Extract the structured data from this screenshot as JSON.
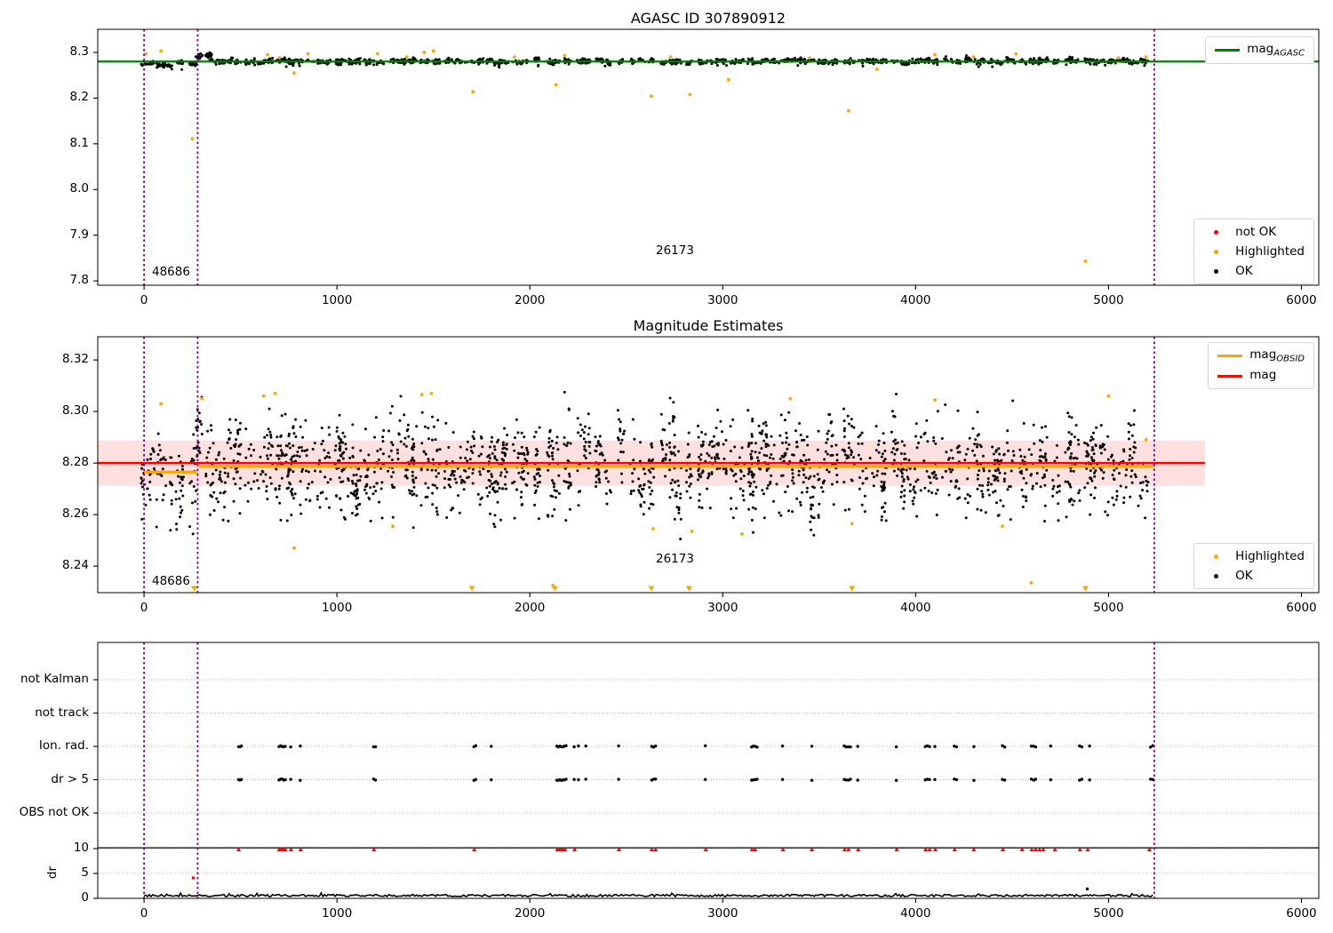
{
  "colors": {
    "ok": "#000000",
    "not_ok": "#ff0000",
    "highlighted": "#ffa500",
    "mag_agasc_line": "#008000",
    "mag_line": "#ff0000",
    "mag_obsid_line": "#ffa500",
    "vline": "#800080",
    "band_fill": "rgba(255,0,0,0.12)",
    "grid": "#bbbbbb",
    "spine": "#000000"
  },
  "chart_data": [
    {
      "type": "scatter",
      "panel": "top",
      "title": "AGASC ID 307890912",
      "xlim": [
        -240,
        6090
      ],
      "ylim": [
        7.7905,
        8.3505
      ],
      "xticks": [
        0,
        1000,
        2000,
        3000,
        4000,
        5000,
        6000
      ],
      "xtick_labels": [
        "0",
        "1000",
        "2000",
        "3000",
        "4000",
        "5000",
        "6000"
      ],
      "yticks": [
        7.8,
        7.9,
        8.0,
        8.1,
        8.2,
        8.3
      ],
      "ytick_labels": [
        "7.8",
        "7.9",
        "8.0",
        "8.1",
        "8.2",
        "8.3"
      ],
      "mag_agasc": 8.28,
      "vlines": [
        0,
        278,
        5237
      ],
      "annotations": [
        {
          "text": "48686",
          "x": 40,
          "y": 7.818
        },
        {
          "text": "26173",
          "x": 2655,
          "y": 7.864
        }
      ],
      "legend_line": [
        {
          "label": "mag",
          "sub": "AGASC"
        }
      ],
      "legend_markers": [
        {
          "label": "not OK",
          "color_key": "not_ok"
        },
        {
          "label": "Highlighted",
          "color_key": "highlighted"
        },
        {
          "label": "OK",
          "color_key": "ok"
        }
      ],
      "band": {
        "seed": 20,
        "x_start": 10,
        "x_end": 5230,
        "mean": 8.2805,
        "sd": 0.0028,
        "cluster_sd": 0.0016,
        "first_seg_end": 278,
        "first_seg_mean": 8.2737,
        "first_seg_sd": 0.0022,
        "bump_range": [
          282,
          368
        ],
        "bump_mean": 8.2915,
        "clip": [
          8.252,
          8.308
        ],
        "pts_min": 8,
        "pts_max": 22,
        "low_frac": 0.015,
        "low_extra": 0.006
      },
      "highlighted_points": [
        [
          10,
          8.297
        ],
        [
          88,
          8.303
        ],
        [
          250,
          8.111
        ],
        [
          640,
          8.295
        ],
        [
          702,
          8.288
        ],
        [
          778,
          8.255
        ],
        [
          850,
          8.297
        ],
        [
          1210,
          8.297
        ],
        [
          1362,
          8.29
        ],
        [
          1452,
          8.3
        ],
        [
          1500,
          8.303
        ],
        [
          1705,
          8.214
        ],
        [
          1920,
          8.29
        ],
        [
          2135,
          8.229
        ],
        [
          2180,
          8.293
        ],
        [
          2630,
          8.204
        ],
        [
          2730,
          8.29
        ],
        [
          2830,
          8.208
        ],
        [
          3030,
          8.24
        ],
        [
          3450,
          8.288
        ],
        [
          3652,
          8.172
        ],
        [
          3800,
          8.263
        ],
        [
          4100,
          8.295
        ],
        [
          4300,
          8.29
        ],
        [
          4520,
          8.297
        ],
        [
          4880,
          7.843
        ],
        [
          5050,
          8.288
        ],
        [
          5195,
          8.29
        ]
      ]
    },
    {
      "type": "scatter",
      "panel": "middle",
      "title": "Magnitude Estimates",
      "xlim": [
        -240,
        6090
      ],
      "ylim": [
        8.2297,
        8.329
      ],
      "xticks": [
        0,
        1000,
        2000,
        3000,
        4000,
        5000,
        6000
      ],
      "xtick_labels": [
        "0",
        "1000",
        "2000",
        "3000",
        "4000",
        "5000",
        "6000"
      ],
      "yticks": [
        8.24,
        8.26,
        8.28,
        8.3,
        8.32
      ],
      "ytick_labels": [
        "8.24",
        "8.26",
        "8.28",
        "8.30",
        "8.32"
      ],
      "mag": 8.28,
      "mag_band": [
        8.2712,
        8.2888
      ],
      "mag_span": [
        -240,
        5500
      ],
      "obsid_segments": [
        [
          0,
          278,
          8.2765
        ],
        [
          282,
          5237,
          8.2787
        ]
      ],
      "vlines": [
        0,
        278,
        5237
      ],
      "annotations": [
        {
          "text": "48686",
          "x": 40,
          "y": 8.2338
        },
        {
          "text": "26173",
          "x": 2655,
          "y": 8.2425
        }
      ],
      "legend_line": [
        {
          "label": "mag",
          "sub": "OBSID"
        },
        {
          "label": "mag",
          "sub": ""
        }
      ],
      "legend_markers": [
        {
          "label": "Highlighted",
          "color_key": "highlighted"
        },
        {
          "label": "OK",
          "color_key": "ok"
        }
      ],
      "band": {
        "seed": 20,
        "x_start": 10,
        "x_end": 5230,
        "mean": 8.2792,
        "sd": 0.0075,
        "cluster_sd": 0.004,
        "first_seg_end": 278,
        "first_seg_mean": 8.2722,
        "first_seg_sd": 0.0055,
        "bump_range": [
          282,
          368
        ],
        "bump_mean": 8.292,
        "clip": [
          8.233,
          8.3075
        ],
        "pts_min": 10,
        "pts_max": 28,
        "low_frac": 0.08,
        "low_extra": 0.016
      },
      "highlighted_points": [
        [
          88,
          8.303
        ],
        [
          300,
          8.305
        ],
        [
          620,
          8.306
        ],
        [
          680,
          8.307
        ],
        [
          778,
          8.247
        ],
        [
          1290,
          8.2555
        ],
        [
          1440,
          8.3065
        ],
        [
          1490,
          8.307
        ],
        [
          2120,
          8.2325
        ],
        [
          2640,
          8.2545
        ],
        [
          2840,
          8.2535
        ],
        [
          3100,
          8.2525
        ],
        [
          3350,
          8.305
        ],
        [
          3670,
          8.2565
        ],
        [
          4100,
          8.3045
        ],
        [
          4450,
          8.2555
        ],
        [
          4600,
          8.2335
        ],
        [
          5000,
          8.306
        ],
        [
          5195,
          8.289
        ]
      ],
      "clip_markers_x": [
        260,
        1700,
        2130,
        2630,
        2825,
        3670,
        4880
      ]
    },
    {
      "type": "scatter",
      "panel": "bottom",
      "categories": [
        "not Kalman",
        "not track",
        "Ion. rad.",
        "dr > 5",
        "OBS not OK"
      ],
      "event_rows": [
        2,
        3
      ],
      "dr_label": "dr",
      "dr_ticks": [
        10,
        5,
        0
      ],
      "dr_tick_labels": [
        "10",
        "5",
        "0"
      ],
      "dr_hline": 10.15,
      "xlim": [
        -240,
        6090
      ],
      "xticks": [
        0,
        1000,
        2000,
        3000,
        4000,
        5000,
        6000
      ],
      "xtick_labels": [
        "0",
        "1000",
        "2000",
        "3000",
        "4000",
        "5000",
        "6000"
      ],
      "vlines": [
        0,
        278,
        5237
      ],
      "event_x": [
        490,
        497,
        505,
        700,
        708,
        716,
        724,
        732,
        760,
        810,
        1190,
        1200,
        1710,
        1720,
        1800,
        2140,
        2148,
        2156,
        2164,
        2172,
        2180,
        2188,
        2230,
        2252,
        2290,
        2460,
        2632,
        2642,
        2652,
        2910,
        3150,
        3158,
        3168,
        3178,
        3310,
        3462,
        3630,
        3640,
        3652,
        3662,
        3700,
        3900,
        4050,
        4060,
        4072,
        4100,
        4200,
        4212,
        4302,
        4450,
        4462,
        4600,
        4612,
        4622,
        4700,
        4850,
        4862,
        4902,
        5218,
        5230
      ],
      "red_dr_x": [
        490,
        700,
        710,
        722,
        732,
        762,
        812,
        1192,
        1712,
        2142,
        2152,
        2162,
        2172,
        2182,
        2232,
        2462,
        2632,
        2652,
        2912,
        3152,
        3168,
        3312,
        3462,
        3632,
        3652,
        3702,
        3902,
        4052,
        4072,
        4102,
        4202,
        4302,
        4452,
        4552,
        4602,
        4622,
        4642,
        4662,
        4722,
        4852,
        4892,
        5212
      ],
      "red_dr_value": 9.8,
      "extra_points": [
        {
          "x": 255,
          "dr": 4.1,
          "color_key": "not_ok"
        },
        {
          "x": 4890,
          "dr": 1.9,
          "color_key": "ok"
        }
      ],
      "trace": {
        "seed": 77,
        "x_start": 0,
        "x_end": 5237,
        "base": 0.55,
        "amp": 0.45
      }
    }
  ]
}
